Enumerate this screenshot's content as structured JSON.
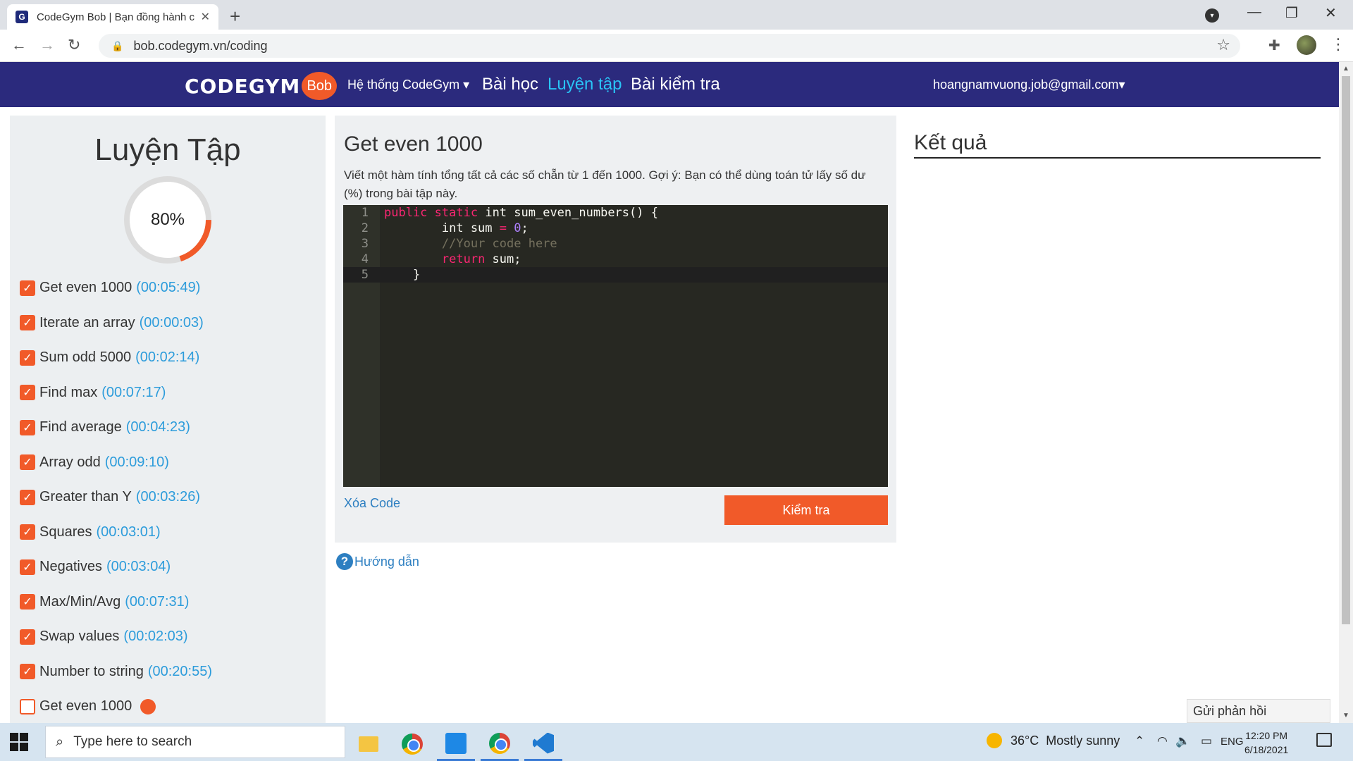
{
  "browser": {
    "tab_title": "CodeGym Bob | Bạn đồng hành c",
    "favicon_letter": "G",
    "url": "bob.codegym.vn/coding"
  },
  "nav": {
    "logo_word": "CODEGYM",
    "logo_bob": "Bob",
    "menu_system": "Hệ thống CodeGym",
    "menu_lessons": "Bài học",
    "menu_practice": "Luyện tập",
    "menu_tests": "Bài kiểm tra",
    "user_email": "hoangnamvuong.job@gmail.com",
    "active_color": "#29c4f6",
    "bar_color": "#2b2a7d"
  },
  "sidebar": {
    "title": "Luyện Tập",
    "progress_percent": 80,
    "progress_label": "80%",
    "exercises": [
      {
        "name": "Get even 1000",
        "time": "(00:05:49)",
        "done": true
      },
      {
        "name": "Iterate an array",
        "time": "(00:00:03)",
        "done": true
      },
      {
        "name": "Sum odd 5000",
        "time": "(00:02:14)",
        "done": true
      },
      {
        "name": "Find max",
        "time": "(00:07:17)",
        "done": true
      },
      {
        "name": "Find average",
        "time": "(00:04:23)",
        "done": true
      },
      {
        "name": "Array odd",
        "time": "(00:09:10)",
        "done": true
      },
      {
        "name": "Greater than Y",
        "time": "(00:03:26)",
        "done": true
      },
      {
        "name": "Squares",
        "time": "(00:03:01)",
        "done": true
      },
      {
        "name": "Negatives",
        "time": "(00:03:04)",
        "done": true
      },
      {
        "name": "Max/Min/Avg",
        "time": "(00:07:31)",
        "done": true
      },
      {
        "name": "Swap values",
        "time": "(00:02:03)",
        "done": true
      },
      {
        "name": "Number to string",
        "time": "(00:20:55)",
        "done": true
      },
      {
        "name": "Get even 1000",
        "time": "",
        "done": false
      }
    ]
  },
  "exercise": {
    "title": "Get even 1000",
    "description": "Viết một hàm tính tổng tất cả các số chẵn từ 1 đến 1000. Gợi ý: Bạn có thể dùng toán tử lấy số dư (%) trong bài tập này.",
    "code_lines": [
      "public static int sum_even_numbers() {",
      "        int sum = 0;",
      "        //Your code here",
      "        return sum;",
      "    }"
    ],
    "clear_label": "Xóa Code",
    "check_label": "Kiểm tra",
    "help_label": "Hướng dẫn"
  },
  "result": {
    "title": "Kết quả"
  },
  "feedback_label": "Gửi phản hồi",
  "taskbar": {
    "search_placeholder": "Type here to search",
    "weather_temp": "36°C",
    "weather_desc": "Mostly sunny",
    "lang": "ENG",
    "time": "12:20 PM",
    "date": "6/18/2021"
  },
  "icons": [
    "g-favicon",
    "close-icon",
    "plus-icon",
    "back-icon",
    "forward-icon",
    "reload-icon",
    "lock-icon",
    "star-icon",
    "puzzle-icon",
    "kebab-icon",
    "check-icon",
    "question-icon",
    "windows-icon",
    "search-icon",
    "folder-icon",
    "chrome-icon",
    "store-icon",
    "vscode-icon",
    "sun-icon",
    "notification-icon"
  ],
  "colors": {
    "accent": "#f15a29",
    "link": "#2d9cdb"
  }
}
